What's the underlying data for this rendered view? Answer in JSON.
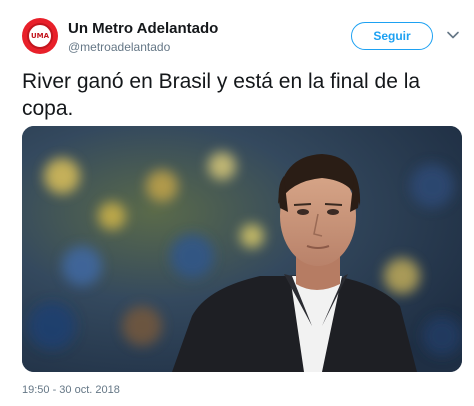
{
  "tweet": {
    "author": {
      "display_name": "Un Metro Adelantado",
      "handle": "@metroadelantado",
      "avatar_text": "UMA"
    },
    "follow_label": "Seguir",
    "text": "River ganó en Brasil y está en la final de la copa.",
    "timestamp": "19:50 - 30 oct. 2018"
  },
  "colors": {
    "accent": "#1da1f2",
    "text": "#14171a",
    "muted": "#657786",
    "avatar": "#e8202a"
  },
  "icons": {
    "more": "chevron-down-icon"
  }
}
